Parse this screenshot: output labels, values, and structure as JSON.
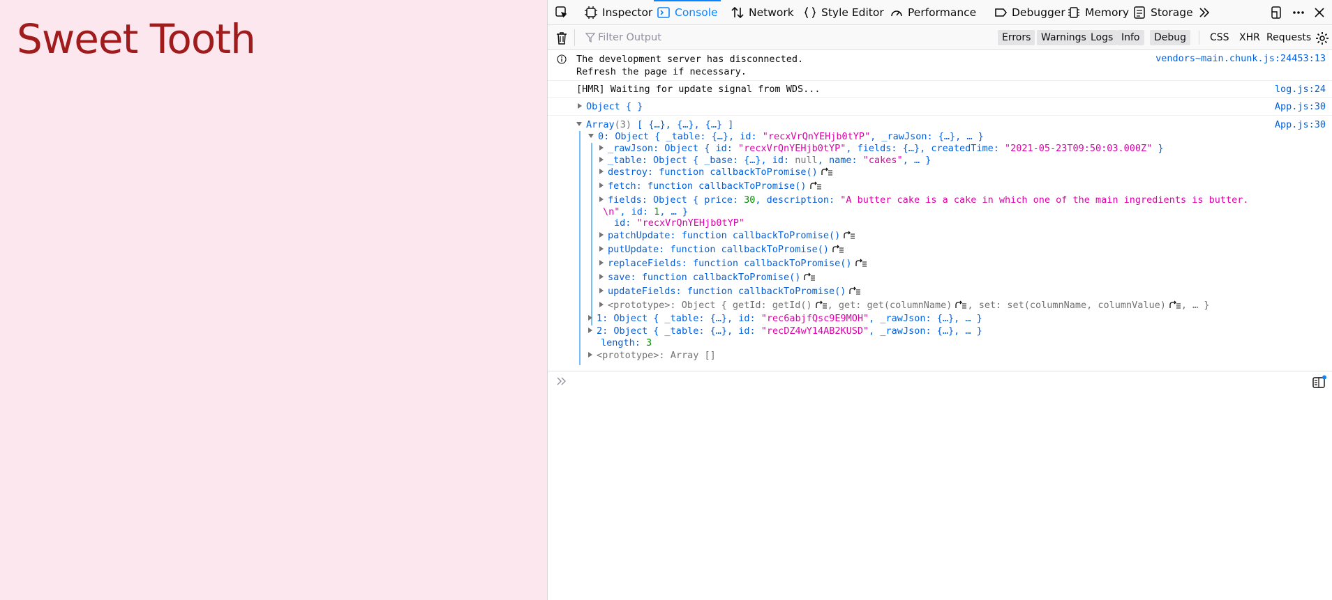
{
  "page": {
    "title": "Sweet Tooth"
  },
  "devtools": {
    "tabs": [
      {
        "label": "Inspector",
        "icon": "inspector-icon"
      },
      {
        "label": "Console",
        "icon": "console-icon"
      },
      {
        "label": "Network",
        "icon": "network-icon"
      },
      {
        "label": "Style Editor",
        "icon": "style-editor-icon"
      },
      {
        "label": "Performance",
        "icon": "performance-icon"
      },
      {
        "label": "Debugger",
        "icon": "debugger-icon"
      },
      {
        "label": "Memory",
        "icon": "memory-icon"
      },
      {
        "label": "Storage",
        "icon": "storage-icon"
      }
    ],
    "selected_tab": "Console",
    "filter": {
      "placeholder": "Filter Output",
      "value": ""
    },
    "levels": [
      "Errors",
      "Warnings",
      "Logs",
      "Info",
      "Debug"
    ],
    "types": [
      "CSS",
      "XHR",
      "Requests"
    ],
    "messages": {
      "m1_line1": "The development server has disconnected.",
      "m1_line2": "Refresh the page if necessary.",
      "m1_loc": "vendors~main.chunk.js:24453:13",
      "m2_text": "[HMR] Waiting for update signal from WDS...",
      "m2_loc": "log.js:24",
      "m3_text": "Object {  }",
      "m3_loc": "App.js:30",
      "m4_loc": "App.js:30"
    },
    "array": {
      "header_prefix": "Array",
      "header_count": "(3)",
      "header_preview": "[ {…}, {…}, {…} ]",
      "item0_key": "0:",
      "item0_summary_a": "Object { _table: {…}, id: ",
      "item0_summary_id": "\"recxVrQnYEHjb0tYP\"",
      "item0_summary_b": ", _rawJson: {…}, … }",
      "rawjson_key": "_rawJson:",
      "rawjson_a": "Object { id: ",
      "rawjson_id": "\"recxVrQnYEHjb0tYP\"",
      "rawjson_b": ", fields: {…}, createdTime: ",
      "rawjson_time": "\"2021-05-23T09:50:03.000Z\"",
      "rawjson_c": " }",
      "table_key": "_table:",
      "table_a": "Object { _base: {…}, id: ",
      "table_null": "null",
      "table_b": ", name: ",
      "table_name": "\"cakes\"",
      "table_c": ", … }",
      "destroy_key": "destroy:",
      "destroy_val": "function callbackToPromise()",
      "fetch_key": "fetch:",
      "fetch_val": "function callbackToPromise()",
      "fields_key": "fields:",
      "fields_a": "Object { price: ",
      "fields_price": "30",
      "fields_b": ", description: ",
      "fields_desc1": "\"A butter cake is a cake in which one of the main ingredients is butter.",
      "fields_desc2": "\\n\"",
      "fields_c": ", id: ",
      "fields_id": "1",
      "fields_d": ", … }",
      "id_key": "id:",
      "id_val": "\"recxVrQnYEHjb0tYP\"",
      "patch_key": "patchUpdate:",
      "patch_val": "function callbackToPromise()",
      "put_key": "putUpdate:",
      "put_val": "function callbackToPromise()",
      "replace_key": "replaceFields:",
      "replace_val": "function callbackToPromise()",
      "save_key": "save:",
      "save_val": "function callbackToPromise()",
      "update_key": "updateFields:",
      "update_val": "function callbackToPromise()",
      "proto_key": "<prototype>:",
      "proto_a": "Object { getId: getId()",
      "proto_b": ", get: get(columnName)",
      "proto_c": ", set: set(columnName, columnValue)",
      "proto_d": ", … }",
      "item1_key": "1:",
      "item1_a": "Object { _table: {…}, id: ",
      "item1_id": "\"rec6abjfQsc9E9MOH\"",
      "item1_b": ", _rawJson: {…}, … }",
      "item2_key": "2:",
      "item2_a": "Object { _table: {…}, id: ",
      "item2_id": "\"recDZ4wY14AB2KUSD\"",
      "item2_b": ", _rawJson: {…}, … }",
      "length_key": "length:",
      "length_val": "3",
      "arr_proto_key": "<prototype>:",
      "arr_proto_val": "Array []"
    }
  }
}
